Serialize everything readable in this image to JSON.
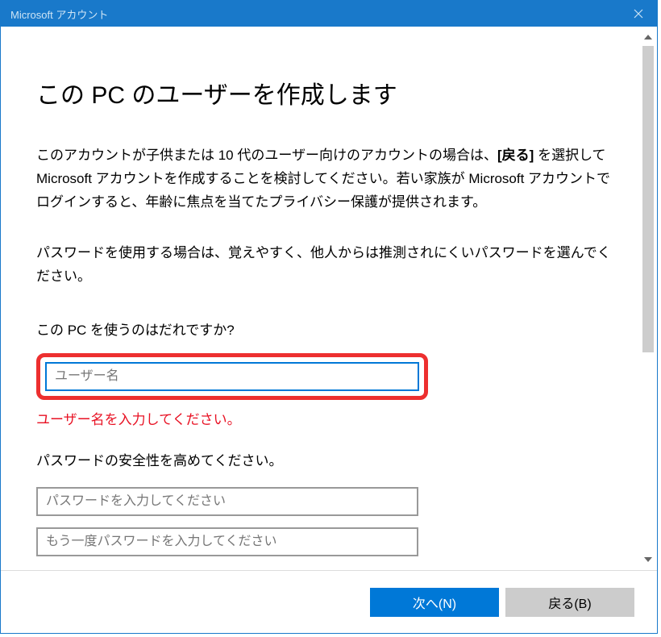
{
  "window": {
    "title": "Microsoft アカウント"
  },
  "page": {
    "title": "この PC のユーザーを作成します",
    "desc1_a": "このアカウントが子供または 10 代のユーザー向けのアカウントの場合は、",
    "desc1_bold": "[戻る]",
    "desc1_b": " を選択して Microsoft アカウントを作成することを検討してください。若い家族が Microsoft アカウントでログインすると、年齢に焦点を当てたプライバシー保護が提供されます。",
    "desc2": "パスワードを使用する場合は、覚えやすく、他人からは推測されにくいパスワードを選んでください。"
  },
  "username": {
    "label": "この PC を使うのはだれですか?",
    "placeholder": "ユーザー名",
    "error": "ユーザー名を入力してください。"
  },
  "password": {
    "label": "パスワードの安全性を高めてください。",
    "placeholder": "パスワードを入力してください",
    "confirm_placeholder": "もう一度パスワードを入力してください"
  },
  "footer": {
    "next": "次へ(N)",
    "back": "戻る(B)"
  }
}
